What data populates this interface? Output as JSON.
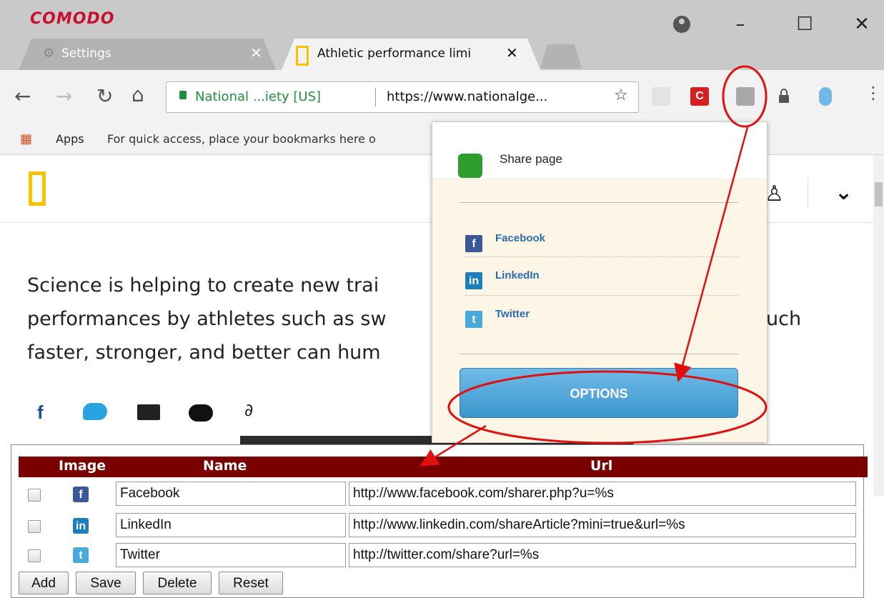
{
  "browser": {
    "brand": "COMODO",
    "tabs": [
      {
        "title": "Settings",
        "active": false
      },
      {
        "title": "Athletic performance limi",
        "active": true
      }
    ],
    "address": {
      "site_identity": "National ...iety [US]",
      "url": "https://www.nationalge..."
    },
    "bookmarks": {
      "apps_label": "Apps",
      "hint": "For quick access, place your bookmarks here o"
    }
  },
  "page": {
    "article_lines": [
      "Science is helping to create new trai",
      "performances by athletes such as sw",
      "faster, stronger, and better can hum"
    ],
    "article_tail": "uch"
  },
  "share_popup": {
    "title": "Share page",
    "links": [
      "Facebook",
      "LinkedIn",
      "Twitter"
    ],
    "options_button": "OPTIONS"
  },
  "options_table": {
    "headers": {
      "image": "Image",
      "name": "Name",
      "url": "Url"
    },
    "rows": [
      {
        "icon": "facebook-icon",
        "name": "Facebook",
        "url": "http://www.facebook.com/sharer.php?u=%s"
      },
      {
        "icon": "linkedin-icon",
        "name": "LinkedIn",
        "url": "http://www.linkedin.com/shareArticle?mini=true&url=%s"
      },
      {
        "icon": "twitter-icon",
        "name": "Twitter",
        "url": "http://twitter.com/share?url=%s"
      }
    ],
    "buttons": [
      "Add",
      "Save",
      "Delete",
      "Reset"
    ]
  },
  "colors": {
    "table_header": "#7a0000",
    "annotation": "#e01010",
    "options_button": "#3c96cf",
    "brand": "#c8102e"
  }
}
